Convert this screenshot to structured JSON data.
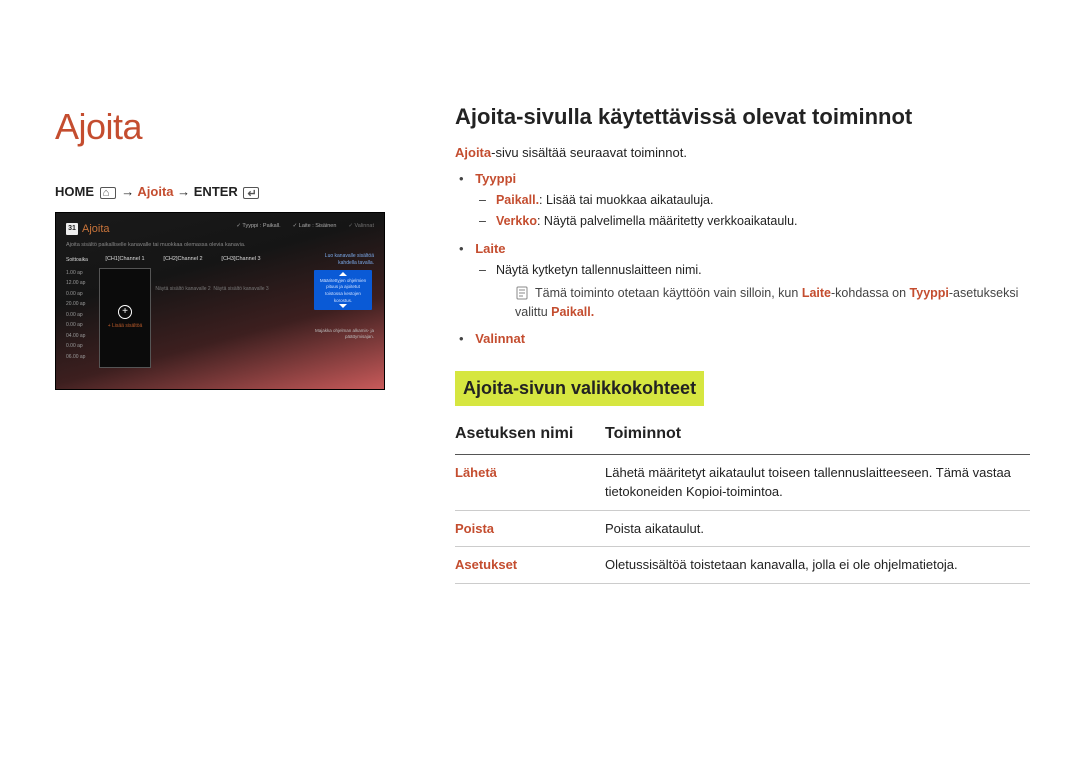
{
  "title": "Ajoita",
  "breadcrumb": {
    "home": "HOME",
    "arrow": "→",
    "mid": "Ajoita",
    "enter": "ENTER"
  },
  "screenshot": {
    "cal": "31",
    "title": "Ajoita",
    "top_type": "Tyyppi : Paikall.",
    "top_device": "Laite : Sisäinen",
    "top_options": "Valinnat",
    "desc": "Ajoita sisältö paikalliselle kanavalle tai muokkaa olemassa olevia kanavia.",
    "col_time_header": "Soittoaika",
    "times": [
      "1.00 ap",
      "12.00 ap",
      "0.00 ap",
      "20.00 ap",
      "0.00 ap",
      "0.00 ap",
      "04.00 ap",
      "0.00 ap",
      "06.00 ap"
    ],
    "ch1": "[CH1]Channel 1",
    "ch2": "[CH2]Channel 2",
    "ch3": "[CH3]Channel 3",
    "ch1_label": "+ Lisää sisältöä",
    "ch2_label": "Näytä sisältö kanavalle 2",
    "ch3_label": "Näytä sisältö kanavalle 3",
    "side1": "Luo kanavalle sisältöä kahdella tavalla.",
    "blue": "Määritettyjen ohjelmien pituus ja ajoitetut toistossa kestojen korostus.",
    "side2": "Majakka ohjelman alkamis- ja päättymisajan."
  },
  "right": {
    "heading": "Ajoita-sivulla käytettävissä olevat toiminnot",
    "intro_pre": "Ajoita",
    "intro_post": "-sivu sisältää seuraavat toiminnot.",
    "features": {
      "tyyppi": {
        "name": "Tyyppi",
        "sub1_pre": "Paikall.",
        "sub1_post": ": Lisää tai muokkaa aikatauluja.",
        "sub2_pre": "Verkko",
        "sub2_post": ": Näytä palvelimella määritetty verkkoaikataulu."
      },
      "laite": {
        "name": "Laite",
        "sub": "Näytä kytketyn tallennuslaitteen nimi.",
        "note_pre": "Tämä toiminto otetaan käyttöön vain silloin, kun ",
        "note_mid1": "Laite",
        "note_mid2": "-kohdassa on ",
        "note_mid3": "Tyyppi",
        "note_mid4": "-asetukseksi valittu ",
        "note_end": "Paikall."
      },
      "valinnat": {
        "name": "Valinnat"
      }
    },
    "subheading": "Ajoita-sivun valikkokohteet",
    "table": {
      "h1": "Asetuksen nimi",
      "h2": "Toiminnot",
      "rows": [
        {
          "name": "Lähetä",
          "desc": "Lähetä määritetyt aikataulut toiseen tallennuslaitteeseen. Tämä vastaa tietokoneiden Kopioi-toimintoa."
        },
        {
          "name": "Poista",
          "desc": "Poista aikataulut."
        },
        {
          "name": "Asetukset",
          "desc": "Oletussisältöä toistetaan kanavalla, jolla ei ole ohjelmatietoja."
        }
      ]
    }
  }
}
